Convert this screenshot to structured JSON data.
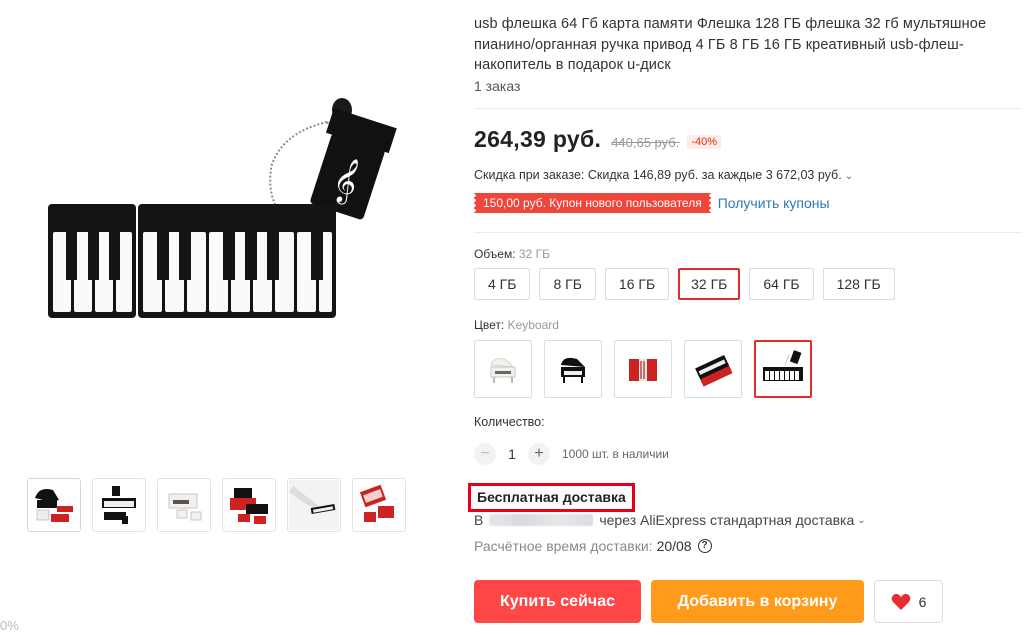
{
  "product": {
    "title": "usb флешка 64 Гб карта памяти Флешка 128 ГБ флешка 32 гб мультяшное пианино/органная ручка привод 4 ГБ 8 ГБ 16 ГБ креативный usb-флеш-накопитель в подарок u-диск",
    "orders": "1 заказ",
    "price": "264,39 руб.",
    "old_price": "440,65 руб.",
    "discount": "-40%",
    "order_discount": "Скидка при заказе: Скидка 146,89 руб. за каждые 3 672,03 руб.",
    "coupon": "150,00 руб. Купон нового пользователя",
    "get_coupons": "Получить купоны"
  },
  "volume": {
    "label": "Объем:",
    "selected": "32 ГБ",
    "options": [
      "4 ГБ",
      "8 ГБ",
      "16 ГБ",
      "32 ГБ",
      "64 ГБ",
      "128 ГБ"
    ],
    "selected_index": 3
  },
  "color": {
    "label": "Цвет:",
    "selected": "Keyboard",
    "options": [
      "white-piano-icon",
      "black-piano-icon",
      "red-accordion-icon",
      "red-keyboard-icon",
      "black-keyboard-icon"
    ],
    "selected_index": 4
  },
  "quantity": {
    "label": "Количество:",
    "minus": "−",
    "value": "1",
    "plus": "+",
    "stock": "1000 шт. в наличии"
  },
  "shipping": {
    "free": "Бесплатная доставка",
    "to": "В",
    "via": "через AliExpress стандартная доставка",
    "eta_label": "Расчётное время доставки:",
    "eta_date": "20/08",
    "help": "?"
  },
  "actions": {
    "buy": "Купить сейчас",
    "cart": "Добавить в корзину",
    "wishlist_count": "6"
  },
  "gallery": {
    "thumbnails": [
      "grand-piano-red",
      "keyboard-black",
      "white-piano",
      "accordion-red",
      "keyboard-laptop",
      "accordion-red-2"
    ]
  },
  "corner_fragment": "0%",
  "colors": {
    "accent_red": "#ff4747",
    "accent_orange": "#ff9a1a",
    "coupon_red": "#f0453a",
    "link_blue": "#2a7ab8",
    "highlight_border": "#e8001a"
  }
}
